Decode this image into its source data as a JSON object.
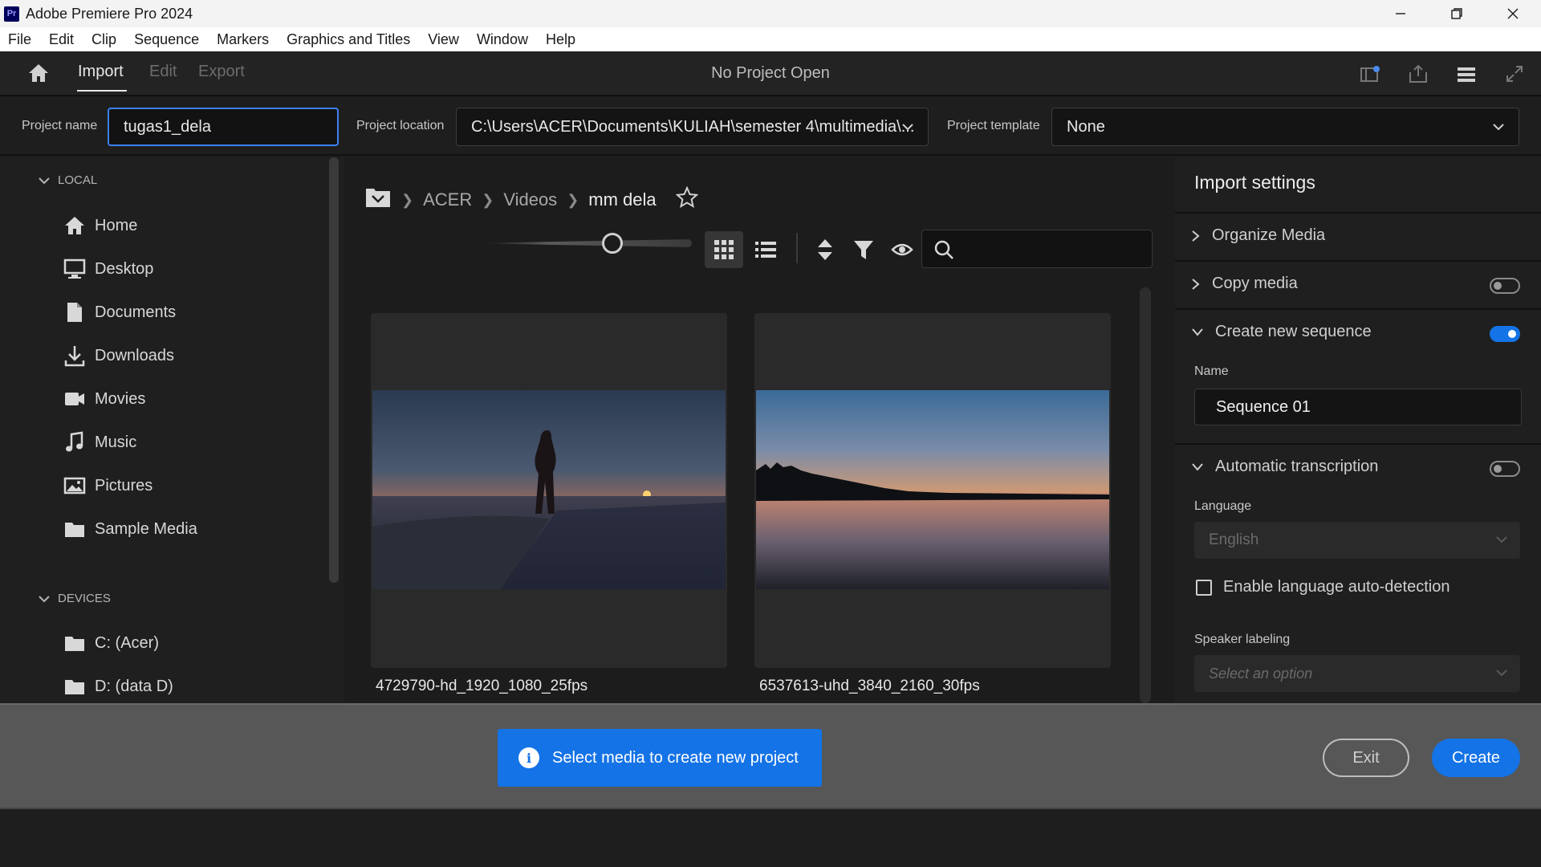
{
  "window": {
    "app_icon_text": "Pr",
    "title": "Adobe Premiere Pro 2024"
  },
  "menu": [
    "File",
    "Edit",
    "Clip",
    "Sequence",
    "Markers",
    "Graphics and Titles",
    "View",
    "Window",
    "Help"
  ],
  "header": {
    "tabs": [
      "Import",
      "Edit",
      "Export"
    ],
    "active_tab": "Import",
    "status": "No Project Open"
  },
  "project": {
    "name_label": "Project name",
    "name_value": "tugas1_dela",
    "location_label": "Project location",
    "location_value": "C:\\Users\\ACER\\Documents\\KULIAH\\semester 4\\multimedia\\...",
    "template_label": "Project template",
    "template_value": "None"
  },
  "sidebar": {
    "local_header": "LOCAL",
    "local_items": [
      {
        "label": "Home",
        "icon": "home-icon"
      },
      {
        "label": "Desktop",
        "icon": "desktop-icon"
      },
      {
        "label": "Documents",
        "icon": "document-icon"
      },
      {
        "label": "Downloads",
        "icon": "download-icon"
      },
      {
        "label": "Movies",
        "icon": "movie-icon"
      },
      {
        "label": "Music",
        "icon": "music-icon"
      },
      {
        "label": "Pictures",
        "icon": "picture-icon"
      },
      {
        "label": "Sample Media",
        "icon": "folder-icon"
      }
    ],
    "devices_header": "DEVICES",
    "devices": [
      {
        "label": "C: (Acer)",
        "icon": "folder-icon"
      },
      {
        "label": "D: (data D)",
        "icon": "folder-icon"
      }
    ]
  },
  "browser": {
    "breadcrumb": [
      "ACER",
      "Videos",
      "mm dela"
    ],
    "search_placeholder": "",
    "media": [
      {
        "name": "4729790-hd_1920_1080_25fps"
      },
      {
        "name": "6537613-uhd_3840_2160_30fps"
      }
    ]
  },
  "import_settings": {
    "title": "Import settings",
    "organize_media": "Organize Media",
    "copy_media": "Copy media",
    "copy_media_on": false,
    "create_sequence": "Create new sequence",
    "create_sequence_on": true,
    "name_label": "Name",
    "name_value": "Sequence 01",
    "auto_transcription": "Automatic transcription",
    "auto_transcription_on": false,
    "language_label": "Language",
    "language_value": "English",
    "auto_detect_label": "Enable language auto-detection",
    "speaker_label": "Speaker labeling",
    "speaker_placeholder": "Select an option"
  },
  "footer": {
    "notice": "Select media to create new project",
    "exit_label": "Exit",
    "create_label": "Create"
  },
  "colors": {
    "accent": "#1473e6",
    "focus": "#3b82f6"
  }
}
